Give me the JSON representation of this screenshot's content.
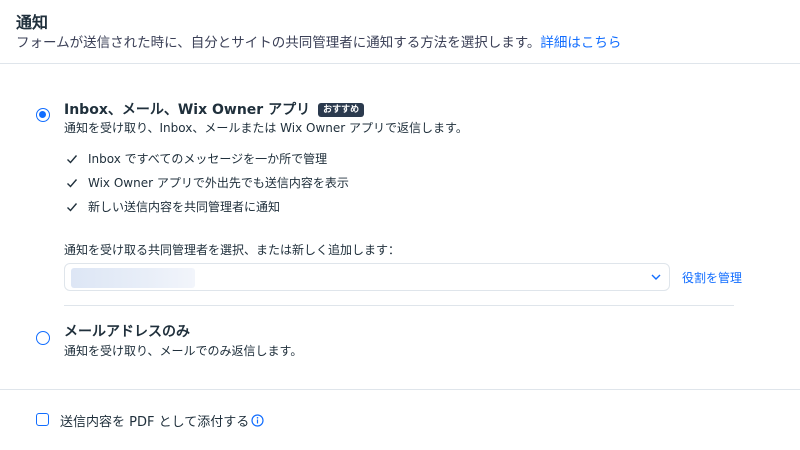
{
  "header": {
    "title": "通知",
    "subtitle": "フォームが送信された時に、自分とサイトの共同管理者に通知する方法を選択します。",
    "details_link": "詳細はこちら"
  },
  "option_inbox": {
    "title": "Inbox、メール、Wix Owner アプリ",
    "badge": "おすすめ",
    "description": "通知を受け取り、Inbox、メールまたは Wix Owner アプリで返信します。",
    "selected": true,
    "features": [
      "Inbox ですべてのメッセージを一か所で管理",
      "Wix Owner アプリで外出先でも送信内容を表示",
      "新しい送信内容を共同管理者に通知"
    ],
    "select_label": "通知を受け取る共同管理者を選択、または新しく追加します：",
    "manage_roles_link": "役割を管理"
  },
  "option_email": {
    "title": "メールアドレスのみ",
    "description": "通知を受け取り、メールでのみ返信します。",
    "selected": false
  },
  "pdf_option": {
    "label": "送信内容を PDF として添付する",
    "checked": false
  },
  "colors": {
    "accent": "#116dff",
    "text": "#20303c",
    "badge_bg": "#2b3a4e",
    "divider": "#dfe5eb"
  },
  "icons": {
    "feature": "checkmark-icon",
    "select": "chevron-down-icon",
    "pdf_info": "info-icon"
  }
}
